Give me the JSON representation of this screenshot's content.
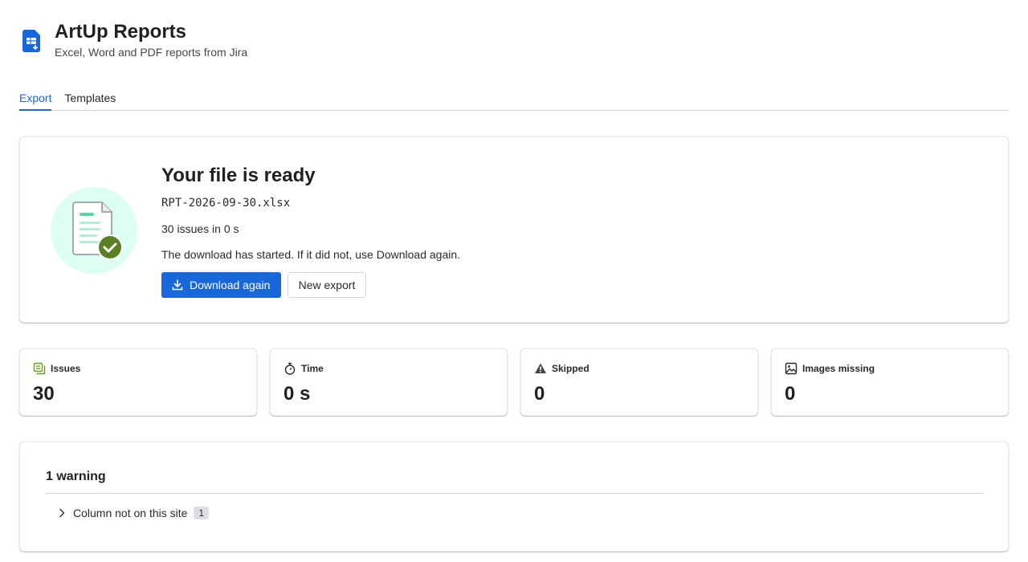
{
  "app": {
    "title": "ArtUp Reports",
    "subtitle": "Excel, Word and PDF reports from Jira",
    "logo_icon": "spreadsheet-download-icon"
  },
  "tabs": [
    {
      "label": "Export",
      "active": true
    },
    {
      "label": "Templates",
      "active": false
    }
  ],
  "result": {
    "title": "Your file is ready",
    "file_name": "RPT-2026-09-30.xlsx",
    "summary": "30 issues in 0 s",
    "note": "The download has started. If it did not, use Download again.",
    "download_label": "Download again",
    "new_export_label": "New export",
    "illustration_icon": "document-check-icon"
  },
  "stats": [
    {
      "label": "Issues",
      "value": "30",
      "icon": "issues-icon"
    },
    {
      "label": "Time",
      "value": "0 s",
      "icon": "stopwatch-icon"
    },
    {
      "label": "Skipped",
      "value": "0",
      "icon": "warning-icon"
    },
    {
      "label": "Images missing",
      "value": "0",
      "icon": "image-icon"
    }
  ],
  "warnings": {
    "title": "1 warning",
    "items": [
      {
        "label": "Column not on this site",
        "count": "1"
      }
    ]
  },
  "colors": {
    "accent": "#1868db",
    "success": "#5b7f24",
    "illustration_bg": "#dcfff1"
  }
}
